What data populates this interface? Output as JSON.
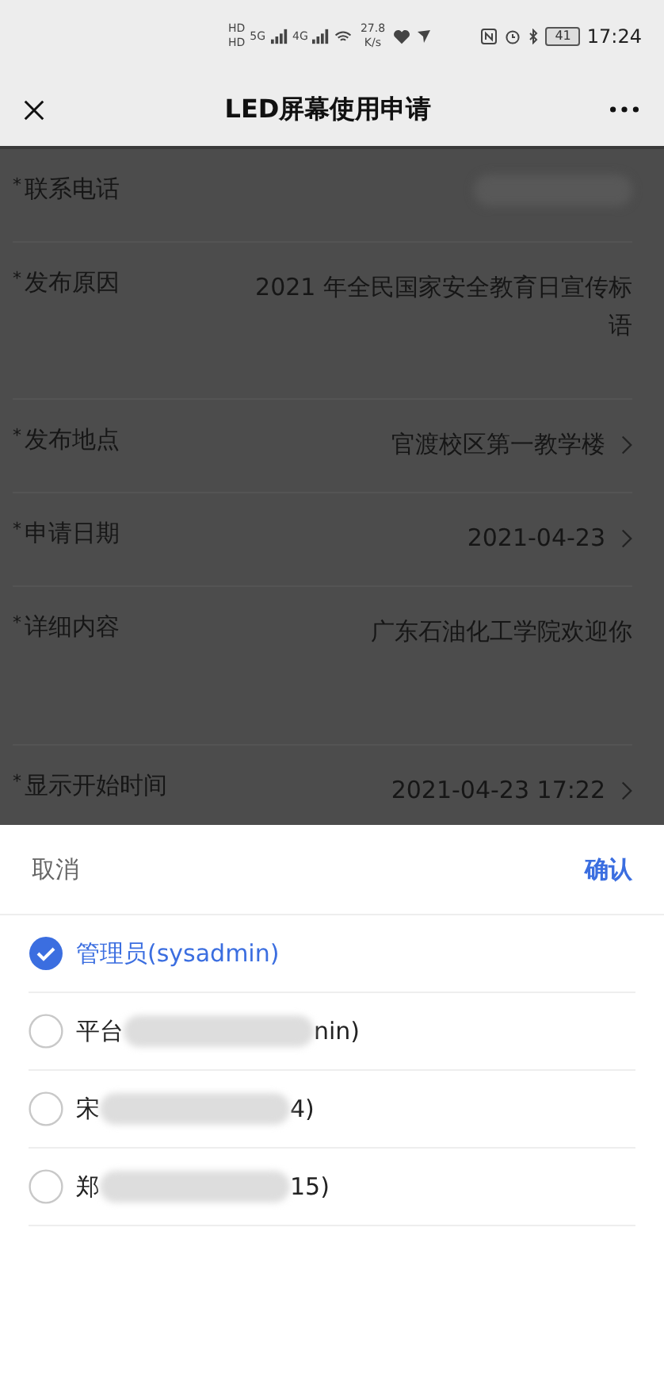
{
  "status_bar": {
    "hd": [
      "HD",
      "HD"
    ],
    "signals": [
      "5G",
      "4G"
    ],
    "speed": "27.8",
    "speed_unit": "K/s",
    "battery": "41",
    "time": "17:24"
  },
  "header": {
    "title": "LED屏幕使用申请"
  },
  "form": [
    {
      "mark": "*",
      "label": "联系电话",
      "kind": "redacted"
    },
    {
      "mark": "*",
      "label": "发布原因",
      "kind": "text",
      "value": "2021 年全民国家安全教育日宣传标语"
    },
    {
      "mark": "*",
      "label": "发布地点",
      "kind": "picker",
      "value": "官渡校区第一教学楼"
    },
    {
      "mark": "*",
      "label": "申请日期",
      "kind": "picker",
      "value": "2021-04-23"
    },
    {
      "mark": "*",
      "label": "详细内容",
      "kind": "text",
      "tall": true,
      "value": "广东石油化工学院欢迎你"
    },
    {
      "mark": "*",
      "label": "显示开始时间",
      "kind": "picker",
      "value": "2021-04-23 17:22"
    }
  ],
  "sheet": {
    "cancel": "取消",
    "confirm": "确认",
    "options": [
      {
        "label_start": "管理员(sysadmin)",
        "selected": true
      },
      {
        "label_start": "平台",
        "label_end": "nin)",
        "redacted": true,
        "selected": false
      },
      {
        "label_start": "宋",
        "label_end": "4)",
        "redacted": true,
        "selected": false
      },
      {
        "label_start": "郑",
        "label_end": "15)",
        "redacted": true,
        "selected": false
      }
    ]
  }
}
